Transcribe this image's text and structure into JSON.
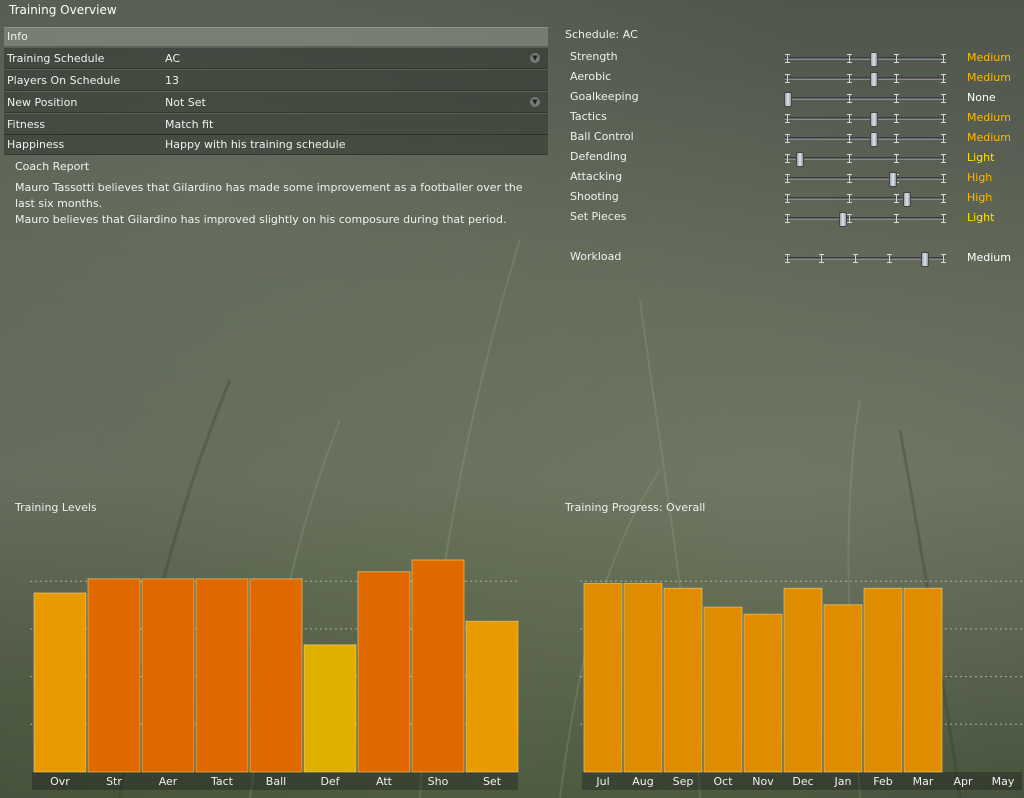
{
  "title": "Training Overview",
  "info": {
    "header": "Info",
    "rows": [
      {
        "label": "Training Schedule",
        "value": "AC",
        "dropdown": true
      },
      {
        "label": "Players On Schedule",
        "value": "13",
        "dropdown": false
      },
      {
        "label": "New Position",
        "value": "Not Set",
        "dropdown": true
      },
      {
        "label": "Fitness",
        "value": "Match fit",
        "dropdown": false
      },
      {
        "label": "Happiness",
        "value": "Happy with his training schedule",
        "dropdown": false
      }
    ]
  },
  "coach_report": {
    "title": "Coach Report",
    "line1": "Mauro Tassotti believes that Gilardino has made some improvement as a footballer over the last six months.",
    "line2": "Mauro believes that Gilardino has improved slightly on his composure during that period."
  },
  "schedule": {
    "title": "Schedule: AC",
    "rows": [
      {
        "label": "Strength",
        "level": "Medium",
        "value": 0.55,
        "color": "#ffb800"
      },
      {
        "label": "Aerobic",
        "level": "Medium",
        "value": 0.55,
        "color": "#ffb800"
      },
      {
        "label": "Goalkeeping",
        "level": "None",
        "value": 0.0,
        "color": "#ffffff"
      },
      {
        "label": "Tactics",
        "level": "Medium",
        "value": 0.55,
        "color": "#ffb800"
      },
      {
        "label": "Ball Control",
        "level": "Medium",
        "value": 0.55,
        "color": "#ffb800"
      },
      {
        "label": "Defending",
        "level": "Light",
        "value": 0.08,
        "color": "#ffe400"
      },
      {
        "label": "Attacking",
        "level": "High",
        "value": 0.67,
        "color": "#ffb800"
      },
      {
        "label": "Shooting",
        "level": "High",
        "value": 0.76,
        "color": "#ffb800"
      },
      {
        "label": "Set Pieces",
        "level": "Light",
        "value": 0.35,
        "color": "#ffe400"
      }
    ],
    "workload": {
      "label": "Workload",
      "level": "Medium",
      "value": 0.88,
      "color": "#ffffff"
    }
  },
  "icons": {
    "dropdown": "chevron-down-icon"
  },
  "chart_data": [
    {
      "type": "bar",
      "title": "Training Levels",
      "categories": [
        "Ovr",
        "Str",
        "Aer",
        "Tact",
        "Ball",
        "Def",
        "Att",
        "Sho",
        "Set"
      ],
      "values": [
        3.8,
        4.1,
        4.1,
        4.1,
        4.1,
        2.7,
        4.25,
        4.5,
        3.2
      ],
      "colors": [
        "#e89a00",
        "#e06800",
        "#e06800",
        "#e06800",
        "#e06800",
        "#e0b000",
        "#e06800",
        "#e06800",
        "#e89a00"
      ],
      "ylim": [
        0,
        4.5
      ],
      "grid": true
    },
    {
      "type": "bar",
      "title": "Training Progress: Overall",
      "categories": [
        "Jul",
        "Aug",
        "Sep",
        "Oct",
        "Nov",
        "Dec",
        "Jan",
        "Feb",
        "Mar",
        "Apr",
        "May"
      ],
      "values": [
        4.0,
        4.0,
        3.9,
        3.5,
        3.35,
        3.9,
        3.55,
        3.9,
        3.9,
        null,
        null
      ],
      "color": "#e08c00",
      "ylim": [
        0,
        4.5
      ],
      "grid": true
    }
  ]
}
